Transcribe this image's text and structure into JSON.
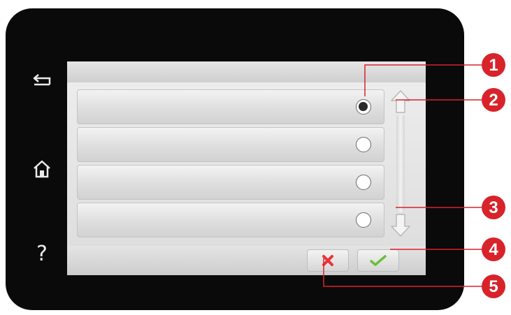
{
  "sidebar": {
    "buttons": [
      {
        "name": "back",
        "icon": "back-arrow-icon"
      },
      {
        "name": "home",
        "icon": "home-icon"
      },
      {
        "name": "help",
        "icon": "question-mark-icon",
        "glyph": "?"
      }
    ]
  },
  "list": {
    "rows": [
      {
        "label": "",
        "selected": true
      },
      {
        "label": "",
        "selected": false
      },
      {
        "label": "",
        "selected": false
      },
      {
        "label": "",
        "selected": false
      }
    ]
  },
  "scrollbar": {
    "up_icon": "scroll-up-arrow-icon",
    "down_icon": "scroll-down-arrow-icon"
  },
  "actions": {
    "cancel_icon": "cancel-x-icon",
    "cancel_color": "#e8333a",
    "ok_icon": "check-icon",
    "ok_color": "#6cbf3a"
  },
  "callouts": {
    "color": "#d8232a",
    "labels": [
      "1",
      "2",
      "3",
      "4",
      "5"
    ]
  }
}
